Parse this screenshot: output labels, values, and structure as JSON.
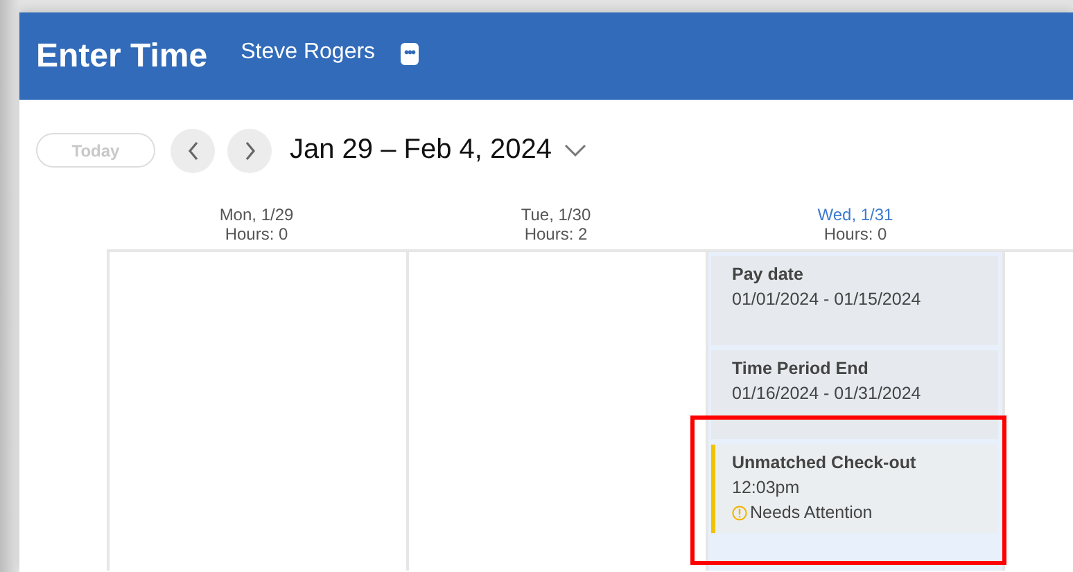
{
  "header": {
    "title": "Enter Time",
    "worker": "Steve Rogers",
    "more_button": "•••"
  },
  "toolbar": {
    "today_button": {
      "label": "Today",
      "disabled": true
    },
    "range": "Jan 29 – Feb 4, 2024"
  },
  "days": [
    {
      "label": "Mon, 1/29",
      "hours": "Hours: 0",
      "today": false
    },
    {
      "label": "Tue, 1/30",
      "hours": "Hours: 2",
      "today": false
    },
    {
      "label": "Wed, 1/31",
      "hours": "Hours: 0",
      "today": true,
      "events": [
        {
          "title": "Pay date",
          "detail": "01/01/2024 - 01/15/2024",
          "kind": "info",
          "highlighted": false
        },
        {
          "title": "Time Period End",
          "detail": "01/16/2024 - 01/31/2024",
          "kind": "info",
          "highlighted": false
        },
        {
          "title": "Unmatched Check-out",
          "detail": "12:03pm",
          "status": "Needs Attention",
          "kind": "warning",
          "highlighted": true
        }
      ]
    }
  ]
}
